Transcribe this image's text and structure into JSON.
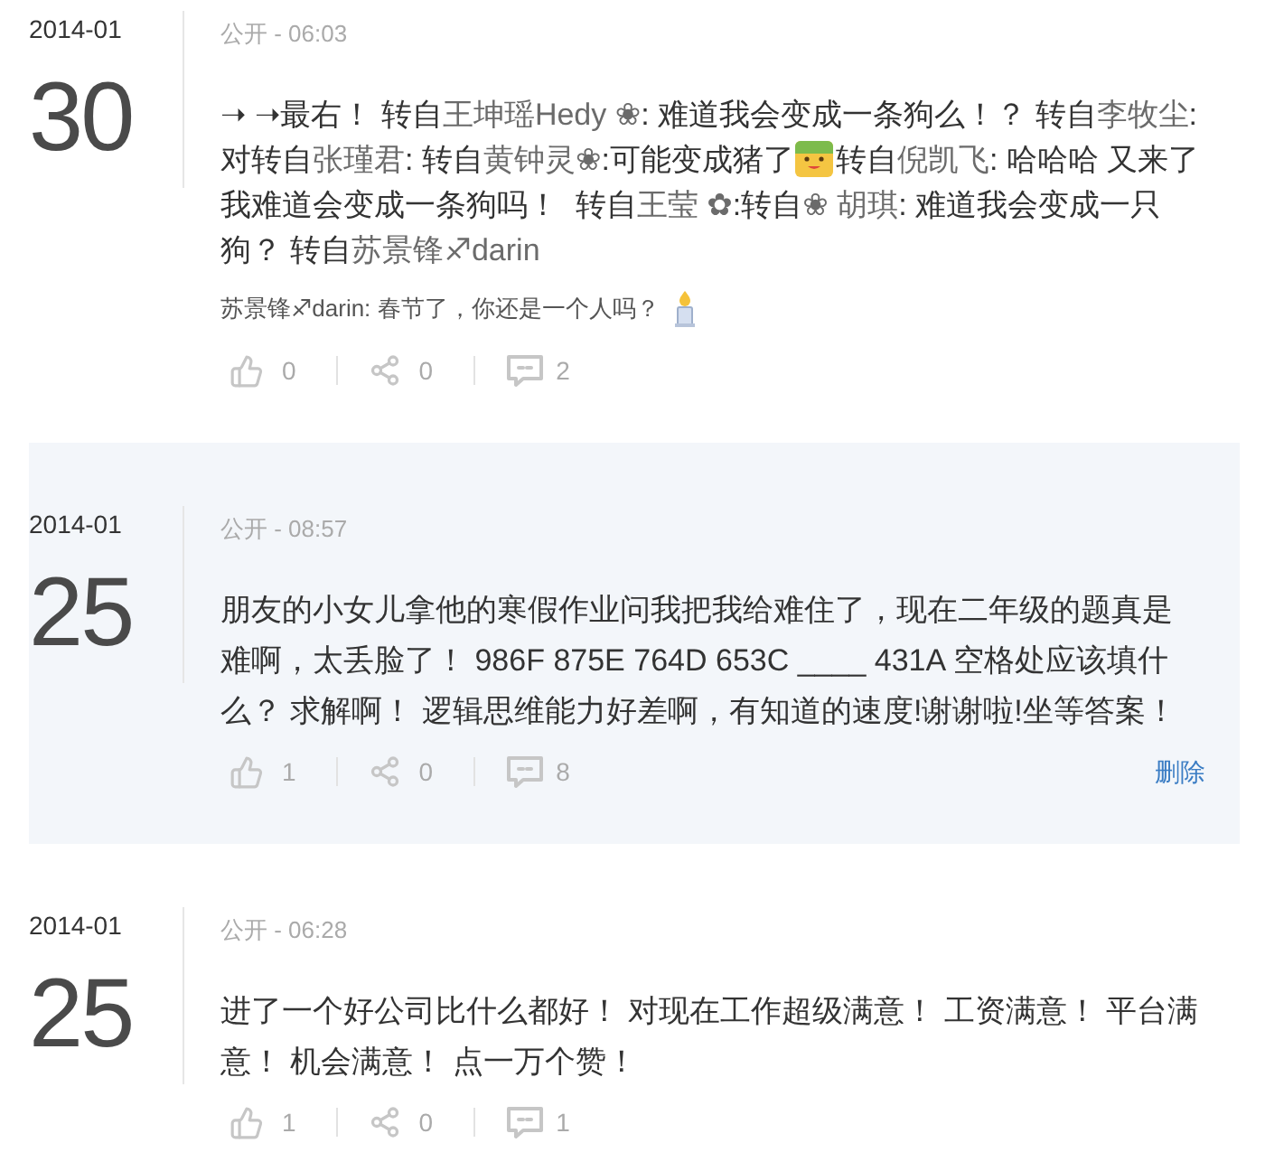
{
  "posts": [
    {
      "highlighted": false,
      "month": "2014-01",
      "day": "30",
      "meta": "公开 - 06:03",
      "content": [
        {
          "kind": "text",
          "text": "➝ ➝最右！ 转自"
        },
        {
          "kind": "mention",
          "text": "王坤瑶Hedy ❀"
        },
        {
          "kind": "text",
          "text": ": 难道我会变成一条狗么！？ 转自"
        },
        {
          "kind": "mention",
          "text": "李牧尘"
        },
        {
          "kind": "text",
          "text": ":对转自"
        },
        {
          "kind": "mention",
          "text": "张瑾君"
        },
        {
          "kind": "text",
          "text": ": 转自"
        },
        {
          "kind": "mention",
          "text": "黄钟灵❀"
        },
        {
          "kind": "text",
          "text": ":可能变成猪了"
        },
        {
          "kind": "emoji"
        },
        {
          "kind": "text",
          "text": "转自"
        },
        {
          "kind": "mention",
          "text": "倪凯飞"
        },
        {
          "kind": "text",
          "text": ": 哈哈哈 又来了我难道会变成一条狗吗！  转自"
        },
        {
          "kind": "mention",
          "text": "王莹 ✿"
        },
        {
          "kind": "text",
          "text": ":转自"
        },
        {
          "kind": "mention",
          "text": "❀ 胡琪"
        },
        {
          "kind": "text",
          "text": ": 难道我会变成一只狗？ 转自"
        },
        {
          "kind": "mention",
          "text": "苏景锋♐darin"
        }
      ],
      "comment": [
        {
          "kind": "text",
          "text": "苏景锋♐darin: 春节了，你还是一个人吗？"
        },
        {
          "kind": "emoji"
        }
      ],
      "likes": "0",
      "shares": "0",
      "comments": "2"
    },
    {
      "highlighted": true,
      "month": "2014-01",
      "day": "25",
      "meta": "公开 - 08:57",
      "content": [
        {
          "kind": "text",
          "text": "朋友的小女儿拿他的寒假作业问我把我给难住了，现在二年级的题真是难啊，太丢脸了！ 986F 875E 764D 653C ____ 431A 空格处应该填什么？ 求解啊！ 逻辑思维能力好差啊，有知道的速度!谢谢啦!坐等答案！"
        }
      ],
      "likes": "1",
      "shares": "0",
      "comments": "8",
      "delete_label": "删除"
    },
    {
      "highlighted": false,
      "month": "2014-01",
      "day": "25",
      "meta": "公开 - 06:28",
      "content": [
        {
          "kind": "text",
          "text": "进了一个好公司比什么都好！ 对现在工作超级满意！ 工资满意！ 平台满意！ 机会满意！ 点一万个赞！"
        }
      ],
      "likes": "1",
      "shares": "0",
      "comments": "1"
    }
  ]
}
